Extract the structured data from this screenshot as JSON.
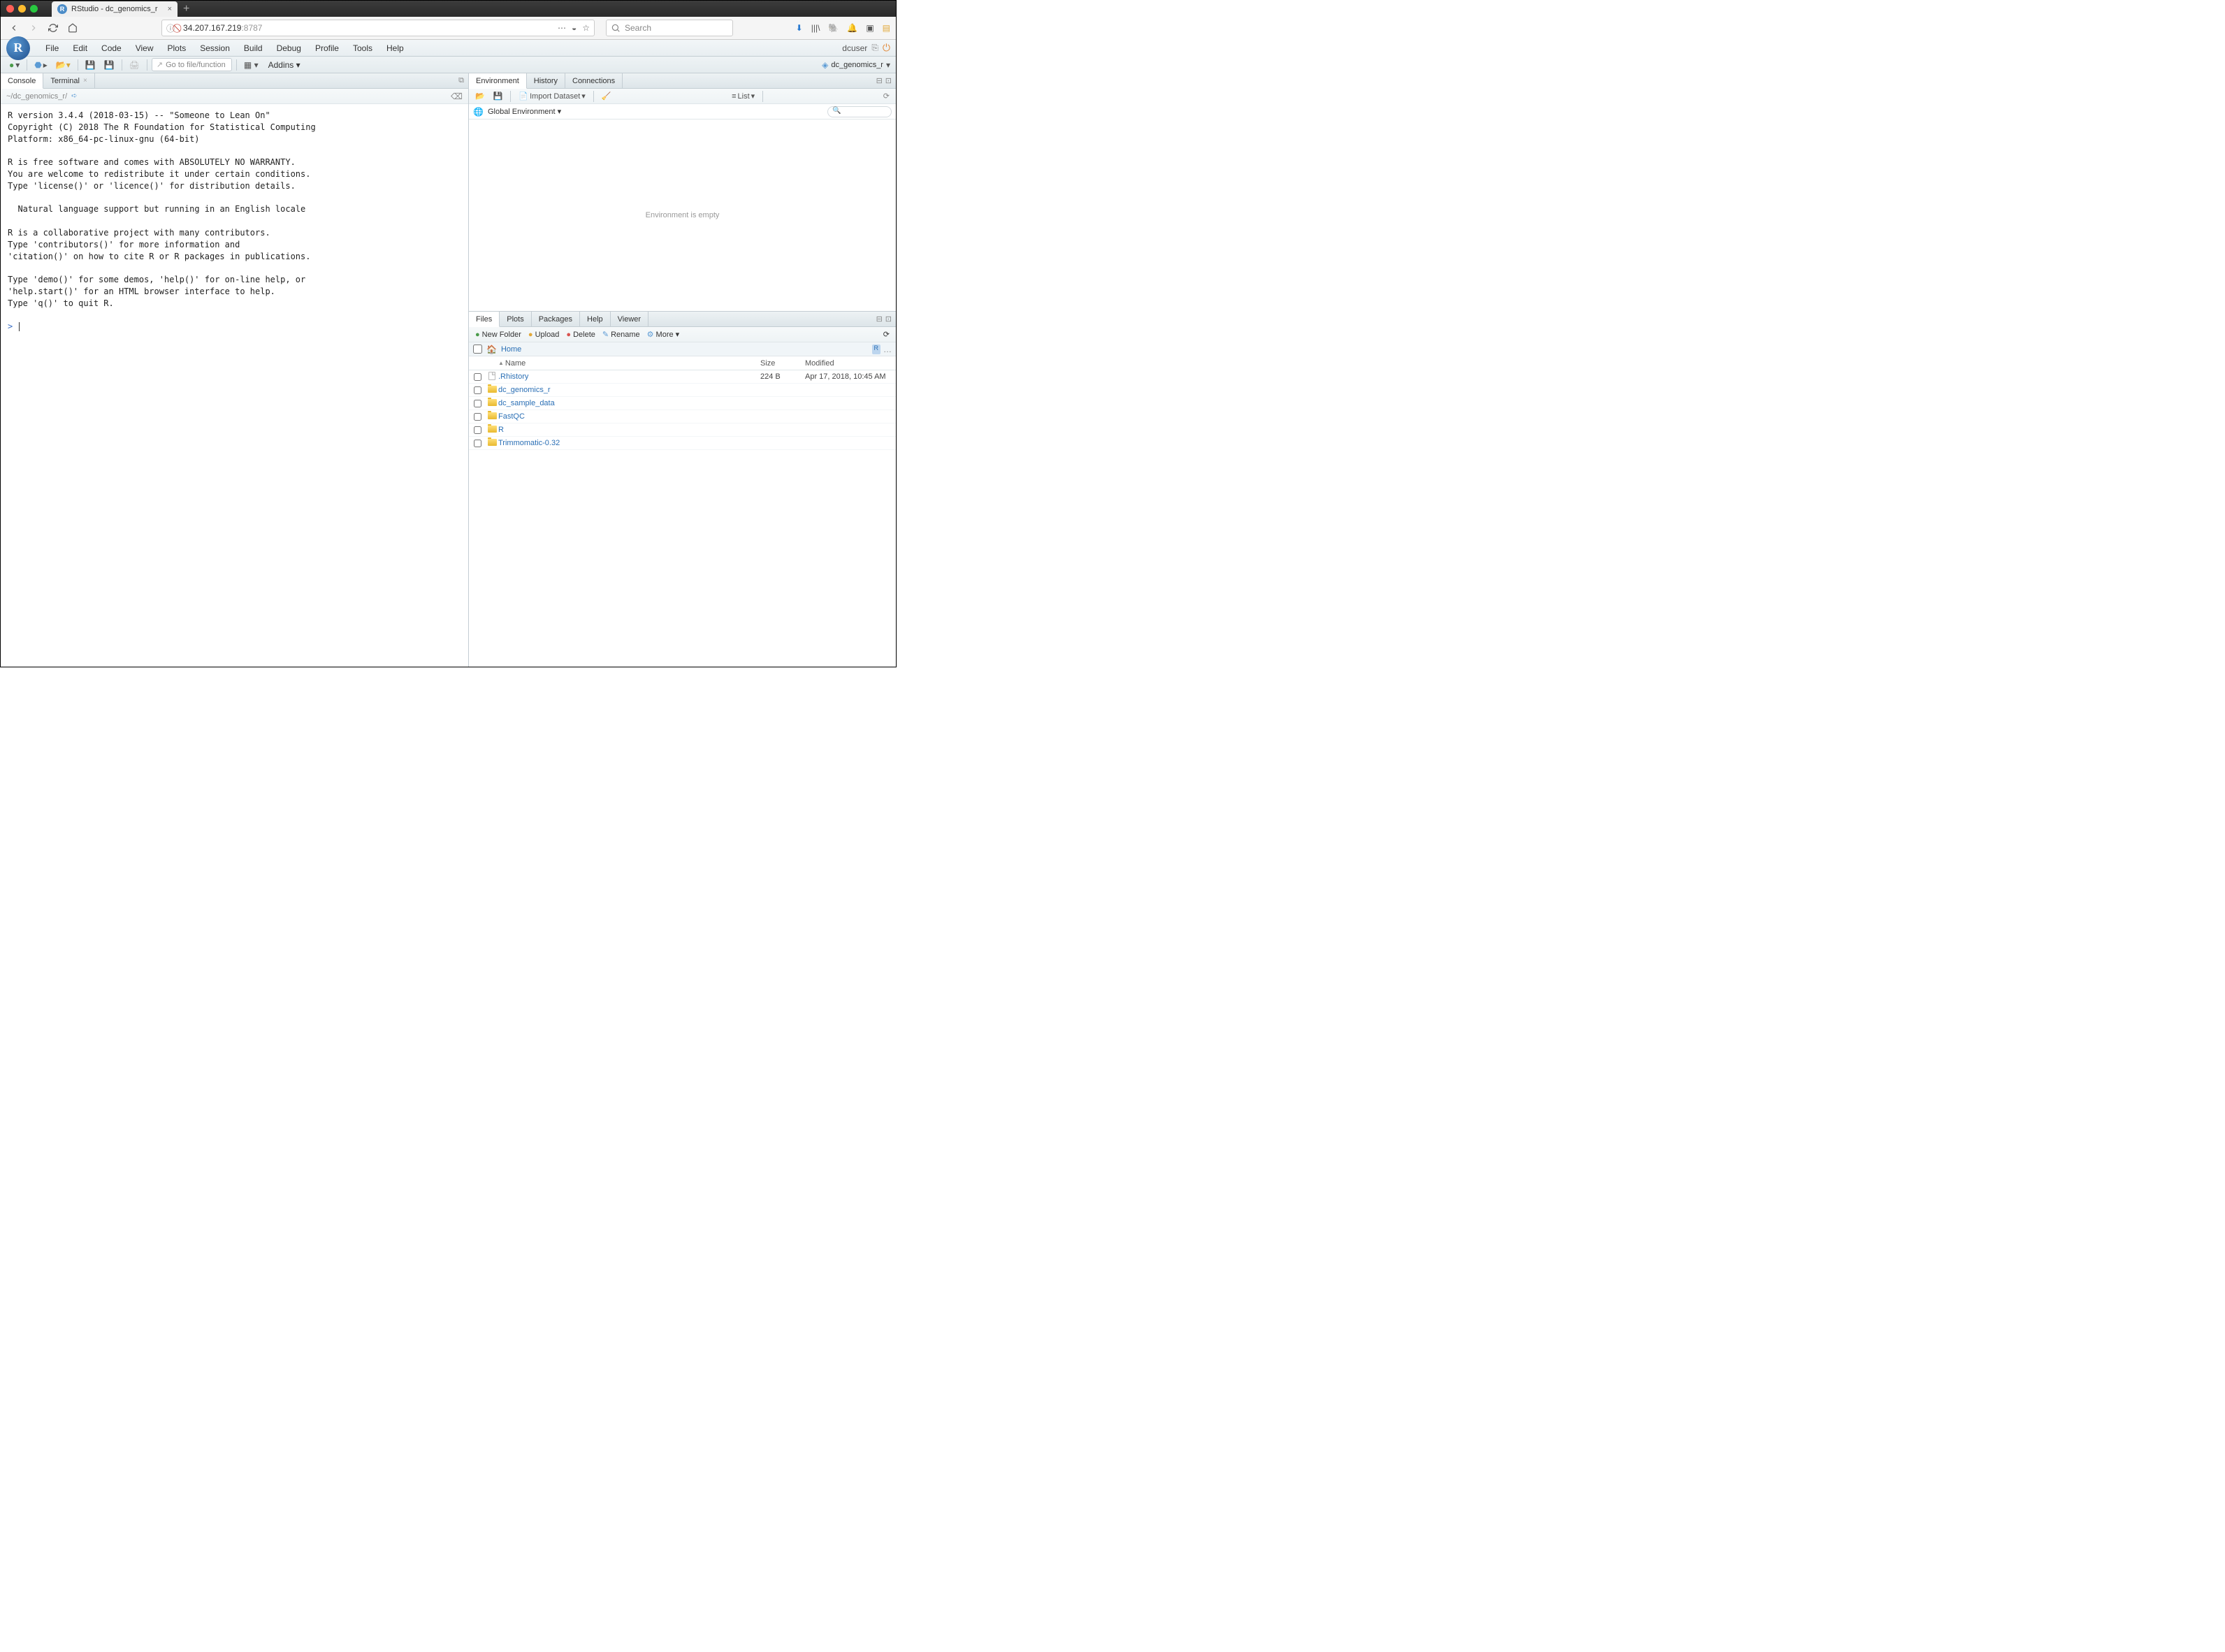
{
  "browser": {
    "tab_title": "RStudio - dc_genomics_r",
    "url_host": "34.207.167.219",
    "url_port": ":8787",
    "search_placeholder": "Search"
  },
  "menu": {
    "items": [
      "File",
      "Edit",
      "Code",
      "View",
      "Plots",
      "Session",
      "Build",
      "Debug",
      "Profile",
      "Tools",
      "Help"
    ],
    "user": "dcuser"
  },
  "toolbar": {
    "go_to_file": "Go to file/function",
    "addins": "Addins",
    "project": "dc_genomics_r"
  },
  "left_pane": {
    "tabs": [
      "Console",
      "Terminal"
    ],
    "active_tab_index": 0,
    "path": "~/dc_genomics_r/",
    "console_text": "R version 3.4.4 (2018-03-15) -- \"Someone to Lean On\"\nCopyright (C) 2018 The R Foundation for Statistical Computing\nPlatform: x86_64-pc-linux-gnu (64-bit)\n\nR is free software and comes with ABSOLUTELY NO WARRANTY.\nYou are welcome to redistribute it under certain conditions.\nType 'license()' or 'licence()' for distribution details.\n\n  Natural language support but running in an English locale\n\nR is a collaborative project with many contributors.\nType 'contributors()' for more information and\n'citation()' on how to cite R or R packages in publications.\n\nType 'demo()' for some demos, 'help()' for on-line help, or\n'help.start()' for an HTML browser interface to help.\nType 'q()' to quit R.\n",
    "prompt": ">"
  },
  "env_pane": {
    "tabs": [
      "Environment",
      "History",
      "Connections"
    ],
    "active_tab_index": 0,
    "import": "Import Dataset",
    "list": "List",
    "scope": "Global Environment",
    "empty": "Environment is empty"
  },
  "files_pane": {
    "tabs": [
      "Files",
      "Plots",
      "Packages",
      "Help",
      "Viewer"
    ],
    "active_tab_index": 0,
    "buttons": {
      "new_folder": "New Folder",
      "upload": "Upload",
      "delete": "Delete",
      "rename": "Rename",
      "more": "More"
    },
    "crumb": "Home",
    "columns": {
      "name": "Name",
      "size": "Size",
      "modified": "Modified"
    },
    "rows": [
      {
        "type": "file",
        "name": ".Rhistory",
        "size": "224 B",
        "modified": "Apr 17, 2018, 10:45 AM"
      },
      {
        "type": "folder",
        "name": "dc_genomics_r",
        "size": "",
        "modified": ""
      },
      {
        "type": "folder",
        "name": "dc_sample_data",
        "size": "",
        "modified": ""
      },
      {
        "type": "folder",
        "name": "FastQC",
        "size": "",
        "modified": ""
      },
      {
        "type": "folder",
        "name": "R",
        "size": "",
        "modified": ""
      },
      {
        "type": "folder",
        "name": "Trimmomatic-0.32",
        "size": "",
        "modified": ""
      }
    ]
  }
}
